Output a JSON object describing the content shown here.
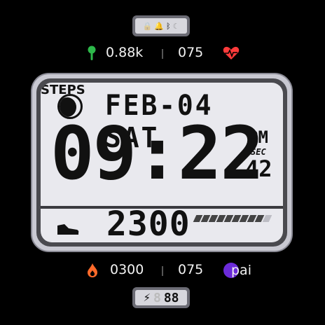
{
  "status_chip": {
    "icons": [
      "lock-icon",
      "bell-icon",
      "bluetooth-icon",
      "moon-icon"
    ]
  },
  "top_row": {
    "left_value": "0.88k",
    "right_value": "075",
    "left_icon": "location-pin-icon",
    "right_icon": "heart-rate-icon",
    "left_icon_color": "#2db84a",
    "right_icon_color": "#ff3b3b"
  },
  "lcd": {
    "date": "FEB-04 SAT",
    "time": "09:22",
    "ampm": "PM",
    "sec_label": "SEC",
    "seconds": "42",
    "steps": "2300",
    "steps_label": "STEPS",
    "steps_progress": 0.9
  },
  "bottom_row": {
    "left_value": "0300",
    "right_value": "075",
    "left_icon": "calories-flame-icon",
    "right_icon": "pai-icon",
    "pai_text": "pai",
    "left_icon_color": "#ff6a2a",
    "right_icon_color": "#6b2bd9"
  },
  "battery_chip": {
    "value": "88",
    "icon": "lightning-icon"
  }
}
